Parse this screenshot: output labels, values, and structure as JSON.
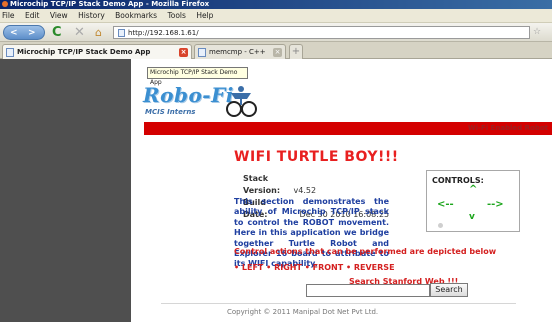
{
  "window": {
    "title": "Microchip TCP/IP Stack Demo App - Mozilla Firefox"
  },
  "menu": {
    "items": [
      {
        "label": "File"
      },
      {
        "label": "Edit"
      },
      {
        "label": "View"
      },
      {
        "label": "History"
      },
      {
        "label": "Bookmarks"
      },
      {
        "label": "Tools"
      },
      {
        "label": "Help"
      }
    ]
  },
  "nav": {
    "back_icon": "back-arrow-icon",
    "forward_icon": "forward-arrow-icon",
    "url": "http://192.168.1.61/"
  },
  "tabs": [
    {
      "label": "Microchip TCP/IP Stack Demo App",
      "active": true
    },
    {
      "label": "memcmp - C++ Reference",
      "active": false
    }
  ],
  "tooltip": "Microchip TCP/IP Stack Demo App",
  "logo": {
    "text": "Robo-Fi",
    "sub": "MCIS Interns"
  },
  "banner": {
    "text": "Wi-Fi Enabled Robot"
  },
  "page": {
    "title": "WIFI TURTLE BOY!!!",
    "stack_version_label": "Stack Version:",
    "stack_version": "v4.52",
    "build_date_label": "Build Date:",
    "build_date": "Dec 30 2010 16:08:25",
    "description": "This section demonstrates the ability of Microchip TCP/IP stack to control the ROBOT movement. Here in this application we bridge together Turtle Robot and Explorer 16 board to attribute to its WIFI capability.",
    "actions_intro": "Control actions that can be performed are depicted below",
    "actions": "• LEFT • RIGHT • FRONT • REVERSE",
    "search_label": "Search Stanford Web !!!",
    "search_value": "",
    "search_button": "Search",
    "copyright": "Copyright © 2011 Manipal Dot Net Pvt Ltd."
  },
  "controls": {
    "title": "CONTROLS:",
    "up": "^",
    "left": "<--",
    "right": "-->",
    "down": "v"
  },
  "colors": {
    "accent_red": "#d40000",
    "title_red": "#e82020",
    "desc_blue": "#1f3fa0",
    "control_green": "#1ca51c"
  }
}
